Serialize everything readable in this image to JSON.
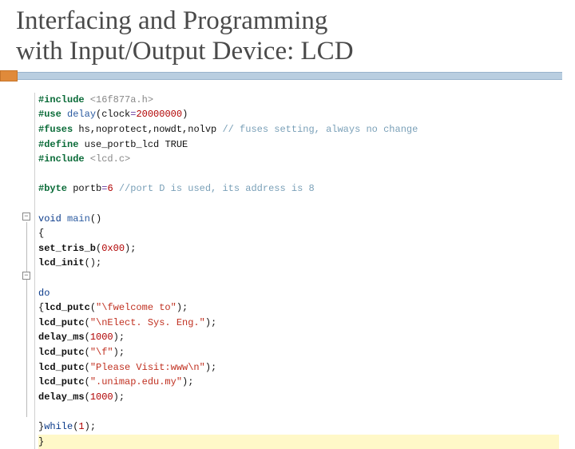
{
  "title_line1": "Interfacing and Programming",
  "title_line2": "with Input/Output Device: LCD",
  "code": {
    "l1a": "#include",
    "l1b": " <16f877a.h>",
    "l2a": "#use",
    "l2b": " delay",
    "l2c": "(clock",
    "l2d": "=",
    "l2e": "20000000",
    "l2f": ")",
    "l3a": "#fuses",
    "l3b": " hs,noprotect,nowdt,nolvp ",
    "l3c": "// fuses setting, always no change",
    "l4a": "#define",
    "l4b": " use_portb_lcd TRUE",
    "l5a": "#include",
    "l5b": " <lcd.c>",
    "blank1": "",
    "l6a": "#byte",
    "l6b": " portb",
    "l6c": "=",
    "l6d": "6",
    "l6e": " //port D is used, its address is 8",
    "blank2": "",
    "l7a": "void",
    "l7b": " main",
    "l7c": "()",
    "l8": "{",
    "l9a": "set_tris_b",
    "l9b": "(",
    "l9c": "0x00",
    "l9d": ");",
    "l10a": "lcd_init",
    "l10b": "();",
    "blank3": "",
    "l11": "do",
    "l12a": "{",
    "l12b": "lcd_putc",
    "l12c": "(",
    "l12d": "\"\\fwelcome to\"",
    "l12e": ");",
    "l13a": "lcd_putc",
    "l13b": "(",
    "l13c": "\"\\nElect. Sys. Eng.\"",
    "l13d": ");",
    "l14a": "delay_ms",
    "l14b": "(",
    "l14c": "1000",
    "l14d": ");",
    "l15a": "lcd_putc",
    "l15b": "(",
    "l15c": "\"\\f\"",
    "l15d": ");",
    "l16a": "lcd_putc",
    "l16b": "(",
    "l16c": "\"Please Visit:www\\n\"",
    "l16d": ");",
    "l17a": "lcd_putc",
    "l17b": "(",
    "l17c": "\".unimap.edu.my\"",
    "l17d": ");",
    "l18a": "delay_ms",
    "l18b": "(",
    "l18c": "1000",
    "l18d": ");",
    "blank4": "",
    "l19a": "}",
    "l19b": "while",
    "l19c": "(",
    "l19d": "1",
    "l19e": ");",
    "l20": "}"
  }
}
